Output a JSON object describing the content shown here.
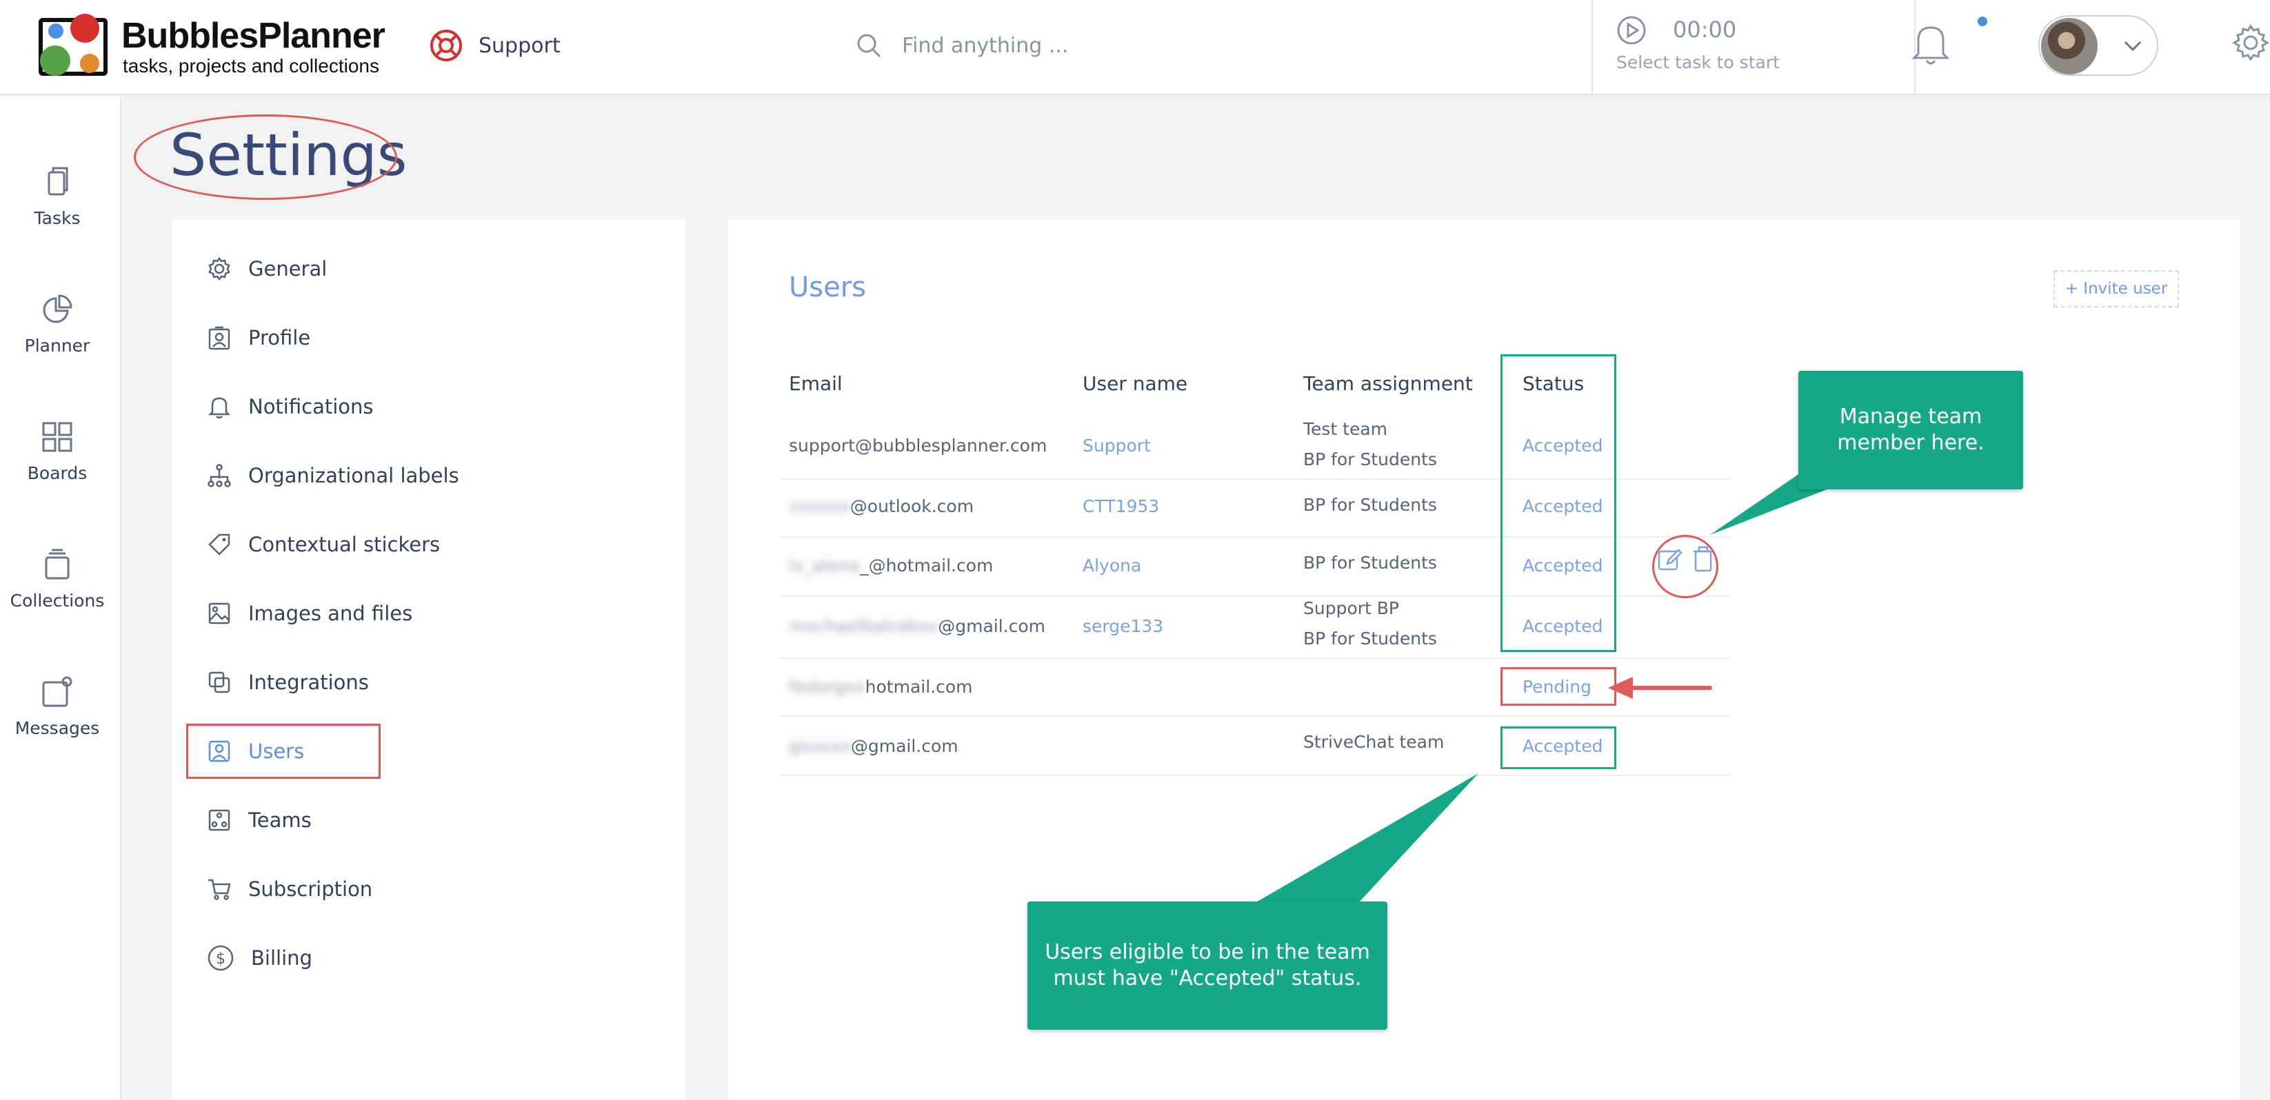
{
  "brand": {
    "name": "BubblesPlanner",
    "tagline": "tasks, projects and collections",
    "colors": {
      "red": "#d7302b",
      "blue": "#4a8fe2",
      "green": "#5aa04a",
      "orange": "#e08a2e"
    }
  },
  "header": {
    "support_label": "Support",
    "search_placeholder": "Find anything ...",
    "timer_time": "00:00",
    "timer_hint": "Select task to start"
  },
  "leftnav": {
    "items": [
      {
        "label": "Tasks",
        "icon": "tasks-icon"
      },
      {
        "label": "Planner",
        "icon": "planner-icon"
      },
      {
        "label": "Boards",
        "icon": "boards-icon"
      },
      {
        "label": "Collections",
        "icon": "collections-icon"
      },
      {
        "label": "Messages",
        "icon": "messages-icon"
      }
    ]
  },
  "page": {
    "title": "Settings"
  },
  "settings_menu": {
    "items": [
      {
        "label": "General",
        "icon": "gear-icon"
      },
      {
        "label": "Profile",
        "icon": "profile-icon"
      },
      {
        "label": "Notifications",
        "icon": "bell-icon"
      },
      {
        "label": "Organizational labels",
        "icon": "org-chart-icon"
      },
      {
        "label": "Contextual stickers",
        "icon": "tag-icon"
      },
      {
        "label": "Images and files",
        "icon": "image-icon"
      },
      {
        "label": "Integrations",
        "icon": "integrations-icon"
      },
      {
        "label": "Users",
        "icon": "user-icon",
        "active": true
      },
      {
        "label": "Teams",
        "icon": "teams-icon"
      },
      {
        "label": "Subscription",
        "icon": "cart-icon"
      },
      {
        "label": "Billing",
        "icon": "dollar-icon"
      }
    ]
  },
  "users": {
    "title": "Users",
    "invite_label": "+ Invite user",
    "columns": [
      "Email",
      "User name",
      "Team assignment",
      "Status"
    ],
    "rows": [
      {
        "email_hidden": "",
        "email": "support@bubblesplanner.com",
        "username": "Support",
        "teams": [
          "Test team",
          "BP for Students"
        ],
        "status": "Accepted"
      },
      {
        "email_hidden": "vxxxxx",
        "email": "@outlook.com",
        "username": "CTT1953",
        "teams": [
          "BP for Students"
        ],
        "status": "Accepted"
      },
      {
        "email_hidden": "lx_alena",
        "email": "_@hotmail.com",
        "username": "Alyona",
        "teams": [
          "BP for Students"
        ],
        "status": "Accepted"
      },
      {
        "email_hidden": "mxchaelbatrakov",
        "email": "@gmail.com",
        "username": "serge133",
        "teams": [
          "Support BP",
          "BP for Students"
        ],
        "status": "Accepted"
      },
      {
        "email_hidden": "fedorgxx",
        "email": "hotmail.com",
        "username": "",
        "teams": [],
        "status": "Pending"
      },
      {
        "email_hidden": "gxxxxx",
        "email": "@gmail.com",
        "username": "",
        "teams": [
          "StriveChat team"
        ],
        "status": "Accepted"
      }
    ]
  },
  "callouts": {
    "manage": "Manage team member here.",
    "eligible": "Users eligible to be in the team must have \"Accepted\" status."
  },
  "annotation_colors": {
    "red": "#e05a5a",
    "green": "#1aa98a"
  }
}
